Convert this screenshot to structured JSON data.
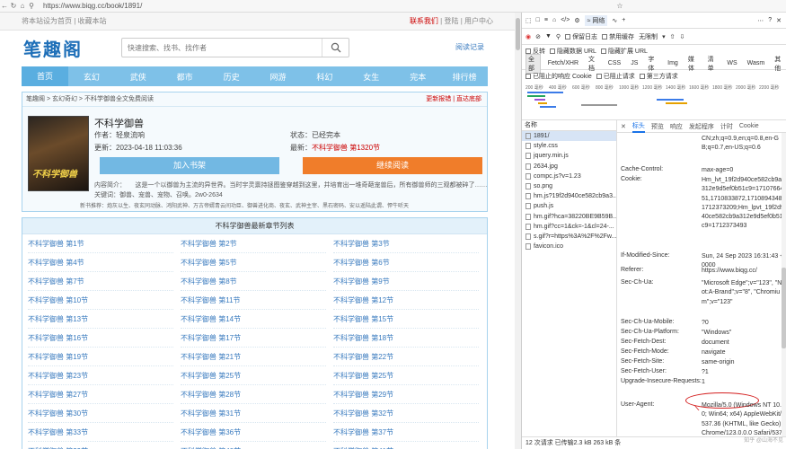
{
  "browser": {
    "url": "https://www.biqg.cc/book/1891/"
  },
  "site": {
    "topbar": {
      "left": "将本站设为首页 | 收藏本站",
      "contact": "联系我们",
      "login": "登陆",
      "user_center": "用户中心"
    },
    "logo": "笔趣阁",
    "search_placeholder": "快速搜索、找书、找作者",
    "read_log": "阅读记录",
    "nav": [
      "首页",
      "玄幻",
      "武侠",
      "都市",
      "历史",
      "网游",
      "科幻",
      "女生",
      "完本",
      "排行榜"
    ],
    "breadcrumb": "笔趣阁 > 玄幻奇幻 > 不科学御兽全文免费阅读",
    "crumb_right": "更新报错 | 直达底部",
    "cover_text": "不科学御兽",
    "book": {
      "title": "不科学御兽",
      "author": "作者：轻泉流响",
      "status": "状态：已经完本",
      "updated": "更新：2023-04-18 11:03:36",
      "latest_label": "最新：",
      "latest": "不科学御兽 第1320节"
    },
    "btn_shelf": "加入书架",
    "btn_read": "继续阅读",
    "intro": "内容简介：　　这是一个以御兽为主流的异世界。当时宇灵禀持拯图鉴穿越到这里，并培育出一堆奇葩宠兽后，所有御兽师的三观都被碎了……关键词：御兽、宠兽、宠物、召唤。2w0-2634",
    "tags": "新书推荐：炮灰以生、夜玄同动脉、鸿阳武神、万古帝婿青云间功臣、御兽进化商、夜玄、武神主宰、黑石密码、安以遥陆此谓、悍牛听天",
    "chapter_title": "不科学御兽最新章节列表",
    "chapters": [
      "不科学御兽 第1节",
      "不科学御兽 第2节",
      "不科学御兽 第3节",
      "不科学御兽 第4节",
      "不科学御兽 第5节",
      "不科学御兽 第6节",
      "不科学御兽 第7节",
      "不科学御兽 第8节",
      "不科学御兽 第9节",
      "不科学御兽 第10节",
      "不科学御兽 第11节",
      "不科学御兽 第12节",
      "不科学御兽 第13节",
      "不科学御兽 第14节",
      "不科学御兽 第15节",
      "不科学御兽 第16节",
      "不科学御兽 第17节",
      "不科学御兽 第18节",
      "不科学御兽 第19节",
      "不科学御兽 第21节",
      "不科学御兽 第22节",
      "不科学御兽 第23节",
      "不科学御兽 第25节",
      "不科学御兽 第25节",
      "不科学御兽 第27节",
      "不科学御兽 第28节",
      "不科学御兽 第29节",
      "不科学御兽 第30节",
      "不科学御兽 第31节",
      "不科学御兽 第32节",
      "不科学御兽 第33节",
      "不科学御兽 第36节",
      "不科学御兽 第37节",
      "不科学御兽 第39节",
      "不科学御兽 第40节",
      "不科学御兽 第41节"
    ]
  },
  "devtools": {
    "tab_network": "网络",
    "preserve_log": "保留日志",
    "disable_cache": "禁用缓存",
    "throttle": "无限制",
    "invert": "反转",
    "hide_data_urls": "隐藏数据 URL",
    "hide_ext_urls": "隐藏扩展 URL",
    "filters": [
      "全部",
      "Fetch/XHR",
      "文档",
      "CSS",
      "JS",
      "字体",
      "Img",
      "媒体",
      "清单",
      "WS",
      "Wasm",
      "其他"
    ],
    "blocked_cookies": "已阻止的响应 Cookie",
    "blocked_requests": "已阻止请求",
    "third_party": "第三方请求",
    "ticks": [
      "200 毫秒",
      "400 毫秒",
      "600 毫秒",
      "800 毫秒",
      "1000 毫秒",
      "1200 毫秒",
      "1400 毫秒",
      "1600 毫秒",
      "1800 毫秒",
      "2000 毫秒",
      "2200 毫秒"
    ],
    "col_name": "名称",
    "requests": [
      "1891/",
      "style.css",
      "jquery.min.js",
      "2634.jpg",
      "compc.js?v=1.23",
      "so.png",
      "hm.js?19f2d940ce582cb9a3...",
      "push.js",
      "hm.gif?hca=38220BE9B59B...",
      "hm.gif?cc=1&ck=-1&cl=24-...",
      "s.gif?r=https%3A%2F%2Fw...",
      "favicon.ico"
    ],
    "detail_tabs": [
      "标头",
      "预览",
      "响应",
      "发起程序",
      "计时",
      "Cookie"
    ],
    "headers": [
      {
        "k": "",
        "v": "CN;zh;q=0.9,en;q=0.8,en-GB;q=0.7,en-US;q=0.6"
      },
      {
        "k": "Cache-Control:",
        "v": "max-age=0"
      },
      {
        "k": "Cookie:",
        "v": "Hm_lvt_19f2d940ce582cb9a312e9d5ef0b51c9=1710766451,1710833872,1710894348,1712373209;Hm_lpvt_19f2d940ce582cb9a312e9d5ef0b51c9=1712373493"
      },
      {
        "k": "If-Modified-Since:",
        "v": "Sun, 24 Sep 2023 16:31:43 +0000"
      },
      {
        "k": "Referer:",
        "v": "https://www.biqg.cc/"
      },
      {
        "k": "Sec-Ch-Ua:",
        "v": "\"Microsoft Edge\";v=\"123\", \"Not:A-Brand\";v=\"8\", \"Chromium\";v=\"123\""
      },
      {
        "k": "Sec-Ch-Ua-Mobile:",
        "v": "?0"
      },
      {
        "k": "Sec-Ch-Ua-Platform:",
        "v": "\"Windows\""
      },
      {
        "k": "Sec-Fetch-Dest:",
        "v": "document"
      },
      {
        "k": "Sec-Fetch-Mode:",
        "v": "navigate"
      },
      {
        "k": "Sec-Fetch-Site:",
        "v": "same-origin"
      },
      {
        "k": "Sec-Fetch-User:",
        "v": "?1"
      },
      {
        "k": "Upgrade-Insecure-Requests:",
        "v": "1"
      },
      {
        "k": "User-Agent:",
        "v": "Mozilla/5.0 (Windows NT 10.0; Win64; x64) AppleWebKit/537.36 (KHTML, like Gecko) Chrome/123.0.0.0 Safari/537.36 Edg/123.0.0.0"
      }
    ],
    "status": "12 次请求  已传输2.3 kB  263 kB 条",
    "watermark": "知乎 @山海不见"
  },
  "colors": {
    "nav": "#7ec1e8",
    "btn_read": "#f07d2a",
    "accent_red": "#c00000",
    "link_blue": "#3a7bbf"
  }
}
